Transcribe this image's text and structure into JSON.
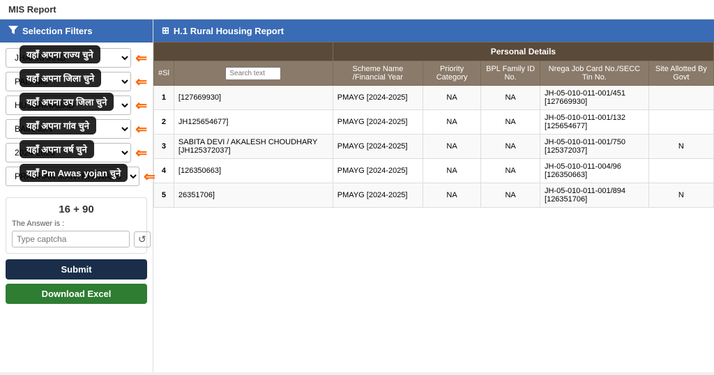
{
  "page": {
    "title": "MIS Report"
  },
  "sidebar": {
    "header": "Selection Filters",
    "filters": [
      {
        "id": "state",
        "value": "JHARKHAND",
        "tooltip": "यहाँ अपना राज्य चुने",
        "options": [
          "JHARKHAND"
        ]
      },
      {
        "id": "district",
        "value": "PALAMU",
        "tooltip": "यहाँ अपना जिला  चुने",
        "options": [
          "PALAMU"
        ]
      },
      {
        "id": "block",
        "value": "HUSSAINABAD",
        "tooltip": "यहाँ अपना उप जिला  चुने",
        "options": [
          "HUSSAINABAD"
        ]
      },
      {
        "id": "panchayat",
        "value": "BAIRAON",
        "tooltip": "यहाँ अपना गांव चुने",
        "options": [
          "BAIRAON"
        ]
      },
      {
        "id": "year",
        "value": "2024-2025",
        "tooltip": "यहाँ अपना वर्ष चुने",
        "options": [
          "2024-2025"
        ]
      },
      {
        "id": "scheme",
        "value": "PRADHAN MANTRI AWAAS",
        "tooltip": "यहाँ Pm Awas yojan चुने",
        "options": [
          "PRADHAN MANTRI AWAAS"
        ]
      }
    ],
    "captcha": {
      "math": "16 + 90",
      "label": "The Answer is :",
      "placeholder": "Type captcha"
    },
    "submit_label": "Submit",
    "download_label": "Download Excel"
  },
  "report": {
    "header": "H.1 Rural Housing Report",
    "personal_details_header": "Personal Details",
    "columns": {
      "sno": "#Sl",
      "search_placeholder": "Search text",
      "scheme_name": "Scheme Name /Financial Year",
      "priority_category": "Priority Category",
      "bpl_family_id": "BPL Family ID No.",
      "nrega_job_card": "Nrega Job Card No./SECC Tin No.",
      "site_allotted": "Site Allotted By Govt"
    },
    "rows": [
      {
        "sno": "1",
        "beneficiary": "[127669930]",
        "scheme": "PMAYG [2024-2025]",
        "priority": "NA",
        "bpl": "NA",
        "nrega": "JH-05-010-011-001/451 [127669930]",
        "site": ""
      },
      {
        "sno": "2",
        "beneficiary": "JH125654677]",
        "scheme": "PMAYG [2024-2025]",
        "priority": "NA",
        "bpl": "NA",
        "nrega": "JH-05-010-011-001/132 [125654677]",
        "site": ""
      },
      {
        "sno": "3",
        "beneficiary": "SABITA DEVI / AKALESH CHOUDHARY [JH125372037]",
        "scheme": "PMAYG [2024-2025]",
        "priority": "NA",
        "bpl": "NA",
        "nrega": "JH-05-010-011-001/750 [125372037]",
        "site": "N"
      },
      {
        "sno": "4",
        "beneficiary": "[126350663]",
        "scheme": "PMAYG [2024-2025]",
        "priority": "NA",
        "bpl": "NA",
        "nrega": "JH-05-010-011-004/96 [126350663]",
        "site": ""
      },
      {
        "sno": "5",
        "beneficiary": "26351706]",
        "scheme": "PMAYG [2024-2025]",
        "priority": "NA",
        "bpl": "NA",
        "nrega": "JH-05-010-011-001/894 [126351706]",
        "site": "N"
      }
    ]
  },
  "icons": {
    "filter": "▼",
    "grid": "⊞",
    "refresh": "↺",
    "arrow": "⇐"
  }
}
